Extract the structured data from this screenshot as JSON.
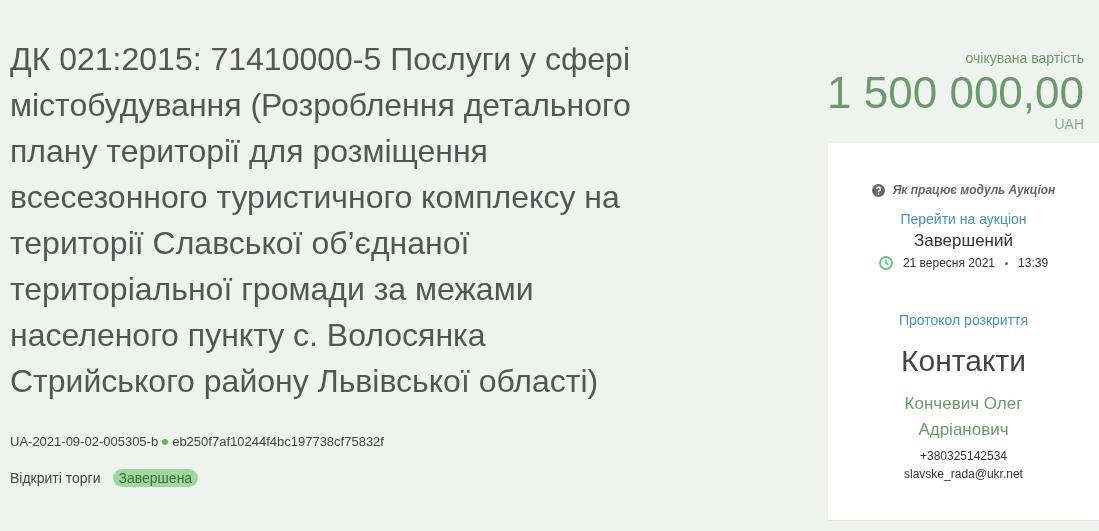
{
  "tender": {
    "title": "ДК 021:2015: 71410000-5 Послуги у сфері містобудування (Розроблення детального плану території для розміщення всесезонного туристичного комплексу на території Славської об’єднаної територіальної громади за межами населеного пункту с. Волосянка Стрийського району Львівської області)",
    "tender_id": "UA-2021-09-02-005305-b",
    "hash": "eb250f7af10244f4bc197738cf75832f",
    "procedure": "Відкриті торги",
    "status": "Завершена"
  },
  "budget": {
    "label": "очікувана вартість",
    "amount": "1 500 000,00",
    "currency": "UAH"
  },
  "auction": {
    "help_link": "Як працює модуль Аукціон",
    "go_link": "Перейти на аукціон",
    "status": "Завершений",
    "date": "21 вересня 2021",
    "time": "13:39"
  },
  "protocol_link": "Протокол розкриття",
  "contacts": {
    "heading": "Контакти",
    "name": "Кончевич Олег Адріанович",
    "phone": "+380325142534",
    "email": "slavske_rada@ukr.net"
  }
}
